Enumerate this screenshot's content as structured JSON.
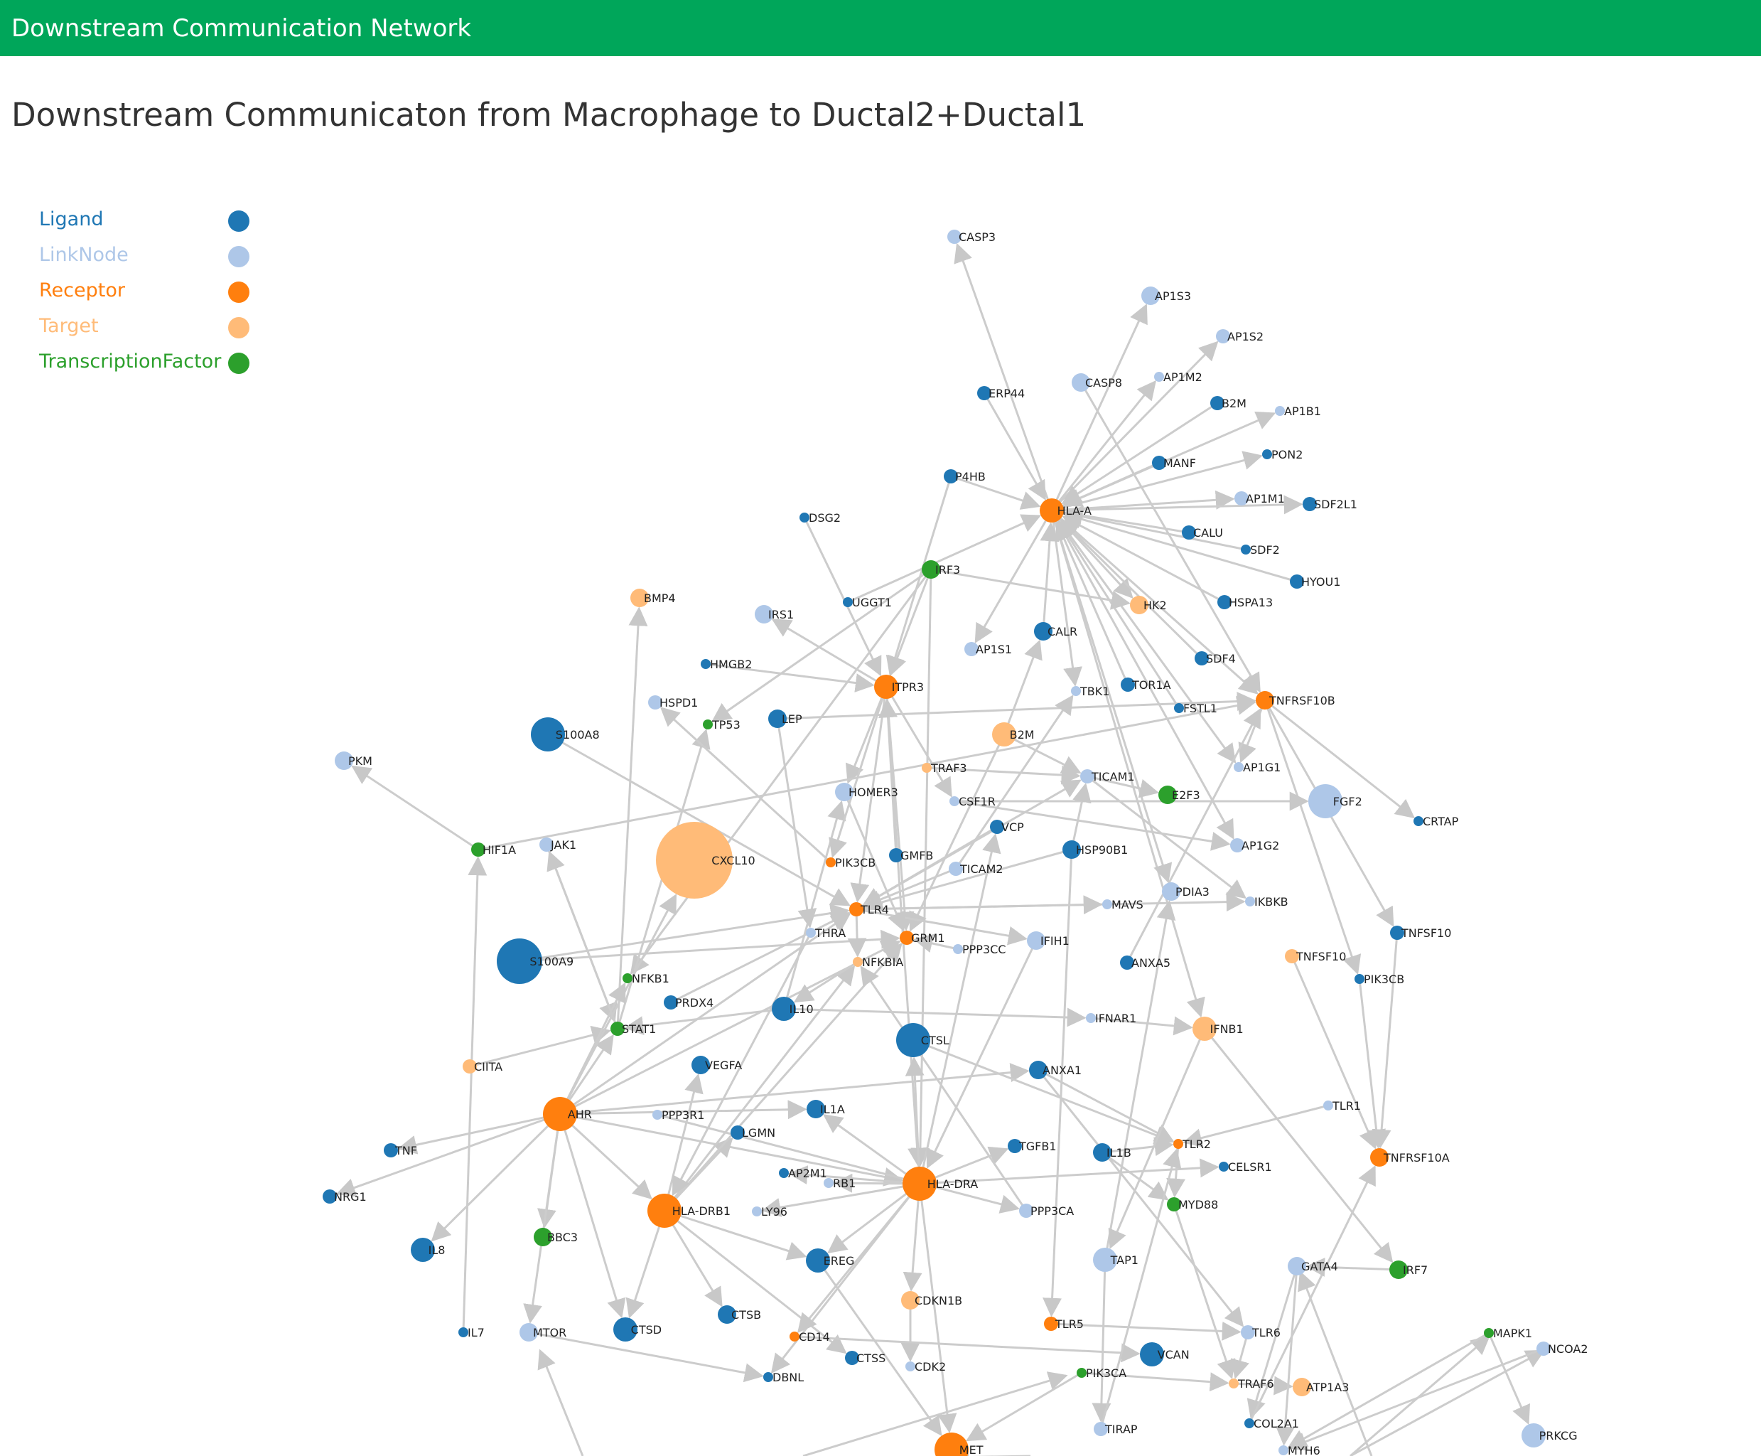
{
  "header": {
    "brand": "Downstream Communication Network"
  },
  "page": {
    "title": "Downstream Communicaton from Macrophage to Ductal2+Ductal1"
  },
  "colors": {
    "Ligand": "#1f77b4",
    "LinkNode": "#aec7e8",
    "Receptor": "#ff7f0e",
    "Target": "#ffbb78",
    "TranscriptionFactor": "#2ca02c",
    "edge": "#cccccc"
  },
  "legend": [
    {
      "label": "Ligand",
      "type": "Ligand"
    },
    {
      "label": "LinkNode",
      "type": "LinkNode"
    },
    {
      "label": "Receptor",
      "type": "Receptor"
    },
    {
      "label": "Target",
      "type": "Target"
    },
    {
      "label": "TranscriptionFactor",
      "type": "TranscriptionFactor"
    }
  ],
  "nodes": [
    {
      "id": "CASP3",
      "type": "LinkNode",
      "size": 1
    },
    {
      "id": "AP1S3",
      "type": "LinkNode",
      "size": 2
    },
    {
      "id": "AP1S2",
      "type": "LinkNode",
      "size": 1
    },
    {
      "id": "AP1M2",
      "type": "LinkNode",
      "size": 0
    },
    {
      "id": "CASP8",
      "type": "LinkNode",
      "size": 2
    },
    {
      "id": "ERP44",
      "type": "Ligand",
      "size": 1
    },
    {
      "id": "B2M",
      "type": "Ligand",
      "size": 1
    },
    {
      "id": "AP1B1",
      "type": "LinkNode",
      "size": 0
    },
    {
      "id": "PON2",
      "type": "Ligand",
      "size": 0
    },
    {
      "id": "MANF",
      "type": "Ligand",
      "size": 1
    },
    {
      "id": "P4HB",
      "type": "Ligand",
      "size": 1
    },
    {
      "id": "AP1M1",
      "type": "LinkNode",
      "size": 1
    },
    {
      "id": "SDF2L1",
      "type": "Ligand",
      "size": 1
    },
    {
      "id": "HLA-A",
      "type": "Receptor",
      "size": 3
    },
    {
      "id": "DSG2",
      "type": "Ligand",
      "size": 0
    },
    {
      "id": "CALU",
      "type": "Ligand",
      "size": 1
    },
    {
      "id": "SDF2",
      "type": "Ligand",
      "size": 0
    },
    {
      "id": "IRF3",
      "type": "TranscriptionFactor",
      "size": 2
    },
    {
      "id": "HYOU1",
      "type": "Ligand",
      "size": 1
    },
    {
      "id": "BMP4",
      "type": "Target",
      "size": 2
    },
    {
      "id": "UGGT1",
      "type": "Ligand",
      "size": 0
    },
    {
      "id": "IRS1",
      "type": "LinkNode",
      "size": 2
    },
    {
      "id": "HSPA13",
      "type": "Ligand",
      "size": 1
    },
    {
      "id": "HK2",
      "type": "Target",
      "size": 2
    },
    {
      "id": "CALR",
      "type": "Ligand",
      "size": 2
    },
    {
      "id": "AP1S1",
      "type": "LinkNode",
      "size": 1
    },
    {
      "id": "HMGB2",
      "type": "Ligand",
      "size": 0
    },
    {
      "id": "SDF4",
      "type": "Ligand",
      "size": 1
    },
    {
      "id": "ITPR3",
      "type": "Receptor",
      "size": 3
    },
    {
      "id": "TBK1",
      "type": "LinkNode",
      "size": 0
    },
    {
      "id": "TOR1A",
      "type": "Ligand",
      "size": 1
    },
    {
      "id": "HSPD1",
      "type": "LinkNode",
      "size": 1
    },
    {
      "id": "TNFRSF10B",
      "type": "Receptor",
      "size": 2
    },
    {
      "id": "FSTL1",
      "type": "Ligand",
      "size": 0
    },
    {
      "id": "TP53",
      "type": "TranscriptionFactor",
      "size": 0
    },
    {
      "id": "LEP",
      "type": "Ligand",
      "size": 2
    },
    {
      "id": "S100A8",
      "type": "Ligand",
      "size": 4
    },
    {
      "id": "B2M_T",
      "label": "B2M",
      "type": "Target",
      "size": 3
    },
    {
      "id": "PKM",
      "type": "LinkNode",
      "size": 2
    },
    {
      "id": "TRAF3",
      "type": "Target",
      "size": 0
    },
    {
      "id": "AP1G1",
      "type": "LinkNode",
      "size": 0
    },
    {
      "id": "TICAM1",
      "type": "LinkNode",
      "size": 1
    },
    {
      "id": "HOMER3",
      "type": "LinkNode",
      "size": 2
    },
    {
      "id": "CSF1R",
      "type": "LinkNode",
      "size": 0
    },
    {
      "id": "E2F3",
      "type": "TranscriptionFactor",
      "size": 2
    },
    {
      "id": "FGF2",
      "type": "LinkNode",
      "size": 4
    },
    {
      "id": "CRTAP",
      "type": "Ligand",
      "size": 0
    },
    {
      "id": "VCP",
      "type": "Ligand",
      "size": 1
    },
    {
      "id": "HIF1A",
      "type": "TranscriptionFactor",
      "size": 1
    },
    {
      "id": "JAK1",
      "type": "LinkNode",
      "size": 1
    },
    {
      "id": "CXCL10",
      "type": "Target",
      "size": 6
    },
    {
      "id": "PIK3CB",
      "type": "Receptor",
      "size": 0
    },
    {
      "id": "GMFB",
      "type": "Ligand",
      "size": 1
    },
    {
      "id": "TICAM2",
      "type": "LinkNode",
      "size": 1
    },
    {
      "id": "HSP90B1",
      "type": "Ligand",
      "size": 2
    },
    {
      "id": "AP1G2",
      "type": "LinkNode",
      "size": 1
    },
    {
      "id": "PDIA3",
      "type": "LinkNode",
      "size": 2
    },
    {
      "id": "MAVS",
      "type": "LinkNode",
      "size": 0
    },
    {
      "id": "IKBKB",
      "type": "LinkNode",
      "size": 0
    },
    {
      "id": "TLR4",
      "type": "Receptor",
      "size": 1
    },
    {
      "id": "THRA",
      "type": "LinkNode",
      "size": 0
    },
    {
      "id": "GRM1",
      "type": "Receptor",
      "size": 1
    },
    {
      "id": "S100A9",
      "type": "Ligand",
      "size": 5
    },
    {
      "id": "IFIH1",
      "type": "LinkNode",
      "size": 2
    },
    {
      "id": "PPP3CC",
      "type": "LinkNode",
      "size": 0
    },
    {
      "id": "TNFSF10",
      "type": "Ligand",
      "size": 1
    },
    {
      "id": "NFKBIA",
      "type": "Target",
      "size": 0
    },
    {
      "id": "ANXA5",
      "type": "Ligand",
      "size": 1
    },
    {
      "id": "TNFSF10_T",
      "label": "TNFSF10",
      "type": "Target",
      "size": 1
    },
    {
      "id": "NFKB1",
      "type": "TranscriptionFactor",
      "size": 0
    },
    {
      "id": "PIK3CB_L",
      "label": "PIK3CB",
      "type": "Ligand",
      "size": 0
    },
    {
      "id": "PRDX4",
      "type": "Ligand",
      "size": 1
    },
    {
      "id": "IL10",
      "type": "Ligand",
      "size": 3
    },
    {
      "id": "STAT1",
      "type": "TranscriptionFactor",
      "size": 1
    },
    {
      "id": "IFNAR1",
      "type": "LinkNode",
      "size": 0
    },
    {
      "id": "IFNB1",
      "type": "Target",
      "size": 3
    },
    {
      "id": "CTSL",
      "type": "Ligand",
      "size": 4
    },
    {
      "id": "CIITA",
      "type": "Target",
      "size": 1
    },
    {
      "id": "VEGFA",
      "type": "Ligand",
      "size": 2
    },
    {
      "id": "ANXA1",
      "type": "Ligand",
      "size": 2
    },
    {
      "id": "IL1A",
      "type": "Ligand",
      "size": 2
    },
    {
      "id": "TLR1",
      "type": "LinkNode",
      "size": 0
    },
    {
      "id": "AHR",
      "type": "Receptor",
      "size": 4
    },
    {
      "id": "PPP3R1",
      "type": "LinkNode",
      "size": 0
    },
    {
      "id": "LGMN",
      "type": "Ligand",
      "size": 1
    },
    {
      "id": "TGFB1",
      "type": "Ligand",
      "size": 1
    },
    {
      "id": "IL1B",
      "type": "Ligand",
      "size": 2
    },
    {
      "id": "TLR2",
      "type": "Receptor",
      "size": 0
    },
    {
      "id": "TNFRSF10A",
      "type": "Receptor",
      "size": 2
    },
    {
      "id": "TNF",
      "type": "Ligand",
      "size": 1
    },
    {
      "id": "CELSR1",
      "type": "Ligand",
      "size": 0
    },
    {
      "id": "AP2M1",
      "type": "Ligand",
      "size": 0
    },
    {
      "id": "RB1",
      "type": "LinkNode",
      "size": 0
    },
    {
      "id": "HLA-DRA",
      "type": "Receptor",
      "size": 4
    },
    {
      "id": "NRG1",
      "type": "Ligand",
      "size": 1
    },
    {
      "id": "HLA-DRB1",
      "type": "Receptor",
      "size": 4
    },
    {
      "id": "LY96",
      "type": "LinkNode",
      "size": 0
    },
    {
      "id": "MYD88",
      "type": "TranscriptionFactor",
      "size": 1
    },
    {
      "id": "PPP3CA",
      "type": "LinkNode",
      "size": 1
    },
    {
      "id": "BBC3",
      "type": "TranscriptionFactor",
      "size": 2
    },
    {
      "id": "IL8",
      "type": "Ligand",
      "size": 3
    },
    {
      "id": "EREG",
      "type": "Ligand",
      "size": 3
    },
    {
      "id": "TAP1",
      "type": "LinkNode",
      "size": 3
    },
    {
      "id": "GATA4",
      "type": "LinkNode",
      "size": 2
    },
    {
      "id": "IRF7",
      "type": "TranscriptionFactor",
      "size": 2
    },
    {
      "id": "CDKN1B",
      "type": "Target",
      "size": 2
    },
    {
      "id": "CTSB",
      "type": "Ligand",
      "size": 2
    },
    {
      "id": "TLR5",
      "type": "Receptor",
      "size": 1
    },
    {
      "id": "IL7",
      "type": "Ligand",
      "size": 0
    },
    {
      "id": "MTOR",
      "type": "LinkNode",
      "size": 2
    },
    {
      "id": "CTSD",
      "type": "Ligand",
      "size": 3
    },
    {
      "id": "TLR6",
      "type": "LinkNode",
      "size": 1
    },
    {
      "id": "MAPK1",
      "type": "TranscriptionFactor",
      "size": 0
    },
    {
      "id": "CD14",
      "type": "Receptor",
      "size": 0
    },
    {
      "id": "VCAN",
      "type": "Ligand",
      "size": 3
    },
    {
      "id": "NCOA2",
      "type": "LinkNode",
      "size": 1
    },
    {
      "id": "CTSS",
      "type": "Ligand",
      "size": 1
    },
    {
      "id": "DBNL",
      "type": "Ligand",
      "size": 0
    },
    {
      "id": "CDK2",
      "type": "LinkNode",
      "size": 0
    },
    {
      "id": "PIK3CA",
      "type": "TranscriptionFactor",
      "size": 0
    },
    {
      "id": "TRAF6",
      "type": "Target",
      "size": 0
    },
    {
      "id": "ATP1A3",
      "type": "Target",
      "size": 2
    },
    {
      "id": "COL2A1",
      "type": "Ligand",
      "size": 0
    },
    {
      "id": "TIRAP",
      "type": "LinkNode",
      "size": 1
    },
    {
      "id": "PRKCG",
      "type": "LinkNode",
      "size": 3
    },
    {
      "id": "MYH6",
      "type": "LinkNode",
      "size": 0
    },
    {
      "id": "MET",
      "type": "Receptor",
      "size": 4
    }
  ],
  "edges": [
    [
      "HLA-A",
      "CASP3"
    ],
    [
      "HLA-A",
      "AP1S3"
    ],
    [
      "HLA-A",
      "AP1S2"
    ],
    [
      "HLA-A",
      "AP1M2"
    ],
    [
      "HLA-A",
      "AP1B1"
    ],
    [
      "HLA-A",
      "PON2"
    ],
    [
      "HLA-A",
      "AP1M1"
    ],
    [
      "HLA-A",
      "SDF2L1"
    ],
    [
      "HLA-A",
      "AP1S1"
    ],
    [
      "HLA-A",
      "HK2"
    ],
    [
      "HLA-A",
      "TNFRSF10B"
    ],
    [
      "HLA-A",
      "AP1G1"
    ],
    [
      "HLA-A",
      "AP1G2"
    ],
    [
      "HLA-A",
      "TBK1"
    ],
    [
      "HLA-A",
      "IFNB1"
    ],
    [
      "HLA-A",
      "PDIA3"
    ],
    [
      "ERP44",
      "HLA-A"
    ],
    [
      "B2M",
      "HLA-A"
    ],
    [
      "MANF",
      "HLA-A"
    ],
    [
      "P4HB",
      "HLA-A"
    ],
    [
      "CALU",
      "HLA-A"
    ],
    [
      "SDF2",
      "HLA-A"
    ],
    [
      "HYOU1",
      "HLA-A"
    ],
    [
      "HSPA13",
      "HLA-A"
    ],
    [
      "CALR",
      "HLA-A"
    ],
    [
      "SDF4",
      "HLA-A"
    ],
    [
      "FSTL1",
      "HLA-A"
    ],
    [
      "TOR1A",
      "HLA-A"
    ],
    [
      "UGGT1",
      "HLA-A"
    ],
    [
      "CASP8",
      "TNFRSF10B"
    ],
    [
      "DSG2",
      "ITPR3"
    ],
    [
      "HMGB2",
      "ITPR3"
    ],
    [
      "IRF3",
      "ITPR3"
    ],
    [
      "ITPR3",
      "IRS1"
    ],
    [
      "ITPR3",
      "CSF1R"
    ],
    [
      "ITPR3",
      "HOMER3"
    ],
    [
      "ITPR3",
      "GRM1"
    ],
    [
      "ITPR3",
      "HLA-DRA"
    ],
    [
      "ITPR3",
      "TLR4"
    ],
    [
      "LEP",
      "TNFRSF10B"
    ],
    [
      "P4HB",
      "ITPR3"
    ],
    [
      "IRF3",
      "TP53"
    ],
    [
      "IRF3",
      "NFKB1"
    ],
    [
      "IRF3",
      "HK2"
    ],
    [
      "IRF3",
      "HLA-DRA"
    ],
    [
      "S100A8",
      "TLR4"
    ],
    [
      "S100A9",
      "TLR4"
    ],
    [
      "S100A9",
      "GRM1"
    ],
    [
      "HIF1A",
      "PKM"
    ],
    [
      "IL7",
      "HIF1A"
    ],
    [
      "HIF1A",
      "TNFRSF10B"
    ],
    [
      "TNFRSF10B",
      "AP1G1"
    ],
    [
      "TNFRSF10B",
      "CRTAP"
    ],
    [
      "TNFRSF10B",
      "TNFSF10"
    ],
    [
      "TNFSF10",
      "TNFRSF10A"
    ],
    [
      "TNFSF10_T",
      "TNFRSF10A"
    ],
    [
      "TNFRSF10B",
      "PIK3CB_L"
    ],
    [
      "PIK3CB_L",
      "TNFRSF10A"
    ],
    [
      "B2M_T",
      "CALR"
    ],
    [
      "B2M_T",
      "GRM1"
    ],
    [
      "B2M_T",
      "TICAM1"
    ],
    [
      "TRAF3",
      "TICAM1"
    ],
    [
      "TICAM1",
      "E2F3"
    ],
    [
      "CSF1R",
      "FGF2"
    ],
    [
      "CSF1R",
      "AP1G2"
    ],
    [
      "TICAM1",
      "IKBKB"
    ],
    [
      "VCP",
      "TLR4"
    ],
    [
      "TICAM2",
      "TLR4"
    ],
    [
      "TICAM2",
      "TBK1"
    ],
    [
      "TLR4",
      "TICAM1"
    ],
    [
      "TLR4",
      "IKBKB"
    ],
    [
      "TLR4",
      "MAVS"
    ],
    [
      "TLR4",
      "IFIH1"
    ],
    [
      "TLR4",
      "NFKBIA"
    ],
    [
      "JAK1",
      "STAT1"
    ],
    [
      "STAT1",
      "JAK1"
    ],
    [
      "STAT1",
      "TP53"
    ],
    [
      "STAT1",
      "BMP4"
    ],
    [
      "CIITA",
      "STAT1"
    ],
    [
      "AHR",
      "STAT1"
    ],
    [
      "AHR",
      "CXCL10"
    ],
    [
      "AHR",
      "NFKB1"
    ],
    [
      "IL10",
      "STAT1"
    ],
    [
      "IL10",
      "IFNAR1"
    ],
    [
      "IFNAR1",
      "IFNB1"
    ],
    [
      "IFNB1",
      "IRF7"
    ],
    [
      "TLR1",
      "TLR2"
    ],
    [
      "TLR2",
      "MYD88"
    ],
    [
      "IL1B",
      "TLR2"
    ],
    [
      "IL1B",
      "MYD88"
    ],
    [
      "ANXA1",
      "TLR2"
    ],
    [
      "ANXA1",
      "TLR6"
    ],
    [
      "AHR",
      "TNF"
    ],
    [
      "AHR",
      "NRG1"
    ],
    [
      "AHR",
      "IL8"
    ],
    [
      "AHR",
      "BBC3"
    ],
    [
      "AHR",
      "MTOR"
    ],
    [
      "AHR",
      "CTSD"
    ],
    [
      "AHR",
      "IL1A"
    ],
    [
      "AHR",
      "HLA-DRB1"
    ],
    [
      "AHR",
      "HLA-DRA"
    ],
    [
      "AHR",
      "GRM1"
    ],
    [
      "AHR",
      "TLR4"
    ],
    [
      "AHR",
      "ANXA1"
    ],
    [
      "HLA-DRB1",
      "LGMN"
    ],
    [
      "HLA-DRB1",
      "CTSB"
    ],
    [
      "HLA-DRB1",
      "CTSD"
    ],
    [
      "HLA-DRB1",
      "CTSS"
    ],
    [
      "HLA-DRB1",
      "EREG"
    ],
    [
      "HLA-DRB1",
      "VEGFA"
    ],
    [
      "HLA-DRB1",
      "GRM1"
    ],
    [
      "HLA-DRB1",
      "NFKBIA"
    ],
    [
      "HLA-DRA",
      "CELSR1"
    ],
    [
      "HLA-DRA",
      "CTSL"
    ],
    [
      "HLA-DRA",
      "TGFB1"
    ],
    [
      "HLA-DRA",
      "IL1A"
    ],
    [
      "HLA-DRA",
      "AP2M1"
    ],
    [
      "HLA-DRA",
      "RB1"
    ],
    [
      "HLA-DRA",
      "LY96"
    ],
    [
      "HLA-DRA",
      "DBNL"
    ],
    [
      "HLA-DRA",
      "CD14"
    ],
    [
      "HLA-DRA",
      "CDKN1B"
    ],
    [
      "HLA-DRA",
      "EREG"
    ],
    [
      "HLA-DRA",
      "VCP"
    ],
    [
      "CDKN1B",
      "CDK2"
    ],
    [
      "CD14",
      "VCAN"
    ],
    [
      "TLR5",
      "TLR6"
    ],
    [
      "TLR6",
      "TRAF6"
    ],
    [
      "MYD88",
      "TRAF6"
    ],
    [
      "TRAF6",
      "ATP1A3"
    ],
    [
      "PIK3CA",
      "TRAF6"
    ],
    [
      "PIK3CA",
      "MET"
    ],
    [
      "TAP1",
      "PDIA3"
    ],
    [
      "TAP1",
      "TIRAP"
    ],
    [
      "TIRAP",
      "TLR2"
    ],
    [
      "GATA4",
      "COL2A1"
    ],
    [
      "COL2A1",
      "TNFRSF10A"
    ],
    [
      "GATA4",
      "MYH6"
    ],
    [
      "MAPK1",
      "PRKCG"
    ],
    [
      "NCOA2",
      "MYH6"
    ],
    [
      "MAPK1",
      "MYH6"
    ],
    [
      "HLA-DRA",
      "MET"
    ],
    [
      "CTSL",
      "TLR2"
    ],
    [
      "EREG",
      "MET"
    ],
    [
      "IRF7",
      "GATA4"
    ],
    [
      "MTOR",
      "DBNL"
    ],
    [
      "IFNB1",
      "TAP1"
    ],
    [
      "ANXA5",
      "TNFRSF10B"
    ],
    [
      "IL10",
      "HOMER3"
    ],
    [
      "PIK3CB",
      "HSPD1"
    ],
    [
      "LEP",
      "THRA"
    ],
    [
      "THRA",
      "HLA-DRB1"
    ],
    [
      "HSP90B1",
      "TLR4"
    ],
    [
      "HSP90B1",
      "TLR5"
    ],
    [
      "GMFB",
      "ITPR3"
    ],
    [
      "PRDX4",
      "TLR4"
    ],
    [
      "ITPR3",
      "PIK3CB"
    ],
    [
      "HOMER3",
      "GRM1"
    ],
    [
      "NFKBIA",
      "IL10"
    ],
    [
      "IFIH1",
      "HLA-DRA"
    ],
    [
      "PPP3CC",
      "GRM1"
    ],
    [
      "PPP3R1",
      "PPP3CA"
    ],
    [
      "PPP3CA",
      "NFKBIA"
    ],
    [
      "HSP90B1",
      "TICAM1"
    ]
  ]
}
